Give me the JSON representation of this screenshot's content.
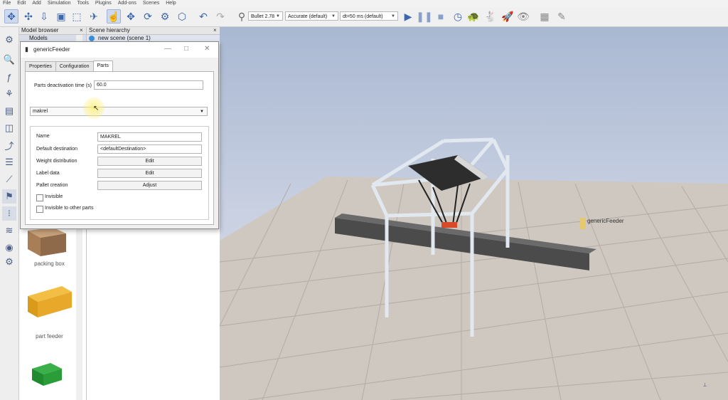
{
  "menu": [
    "File",
    "Edit",
    "Add",
    "Simulation",
    "Tools",
    "Plugins",
    "Add-ons",
    "Scenes",
    "Help"
  ],
  "toolbar": {
    "engine": "Bullet 2.78",
    "accuracy": "Accurate (default)",
    "timestep": "dt=50 ms (default)"
  },
  "panes": {
    "model_browser_title": "Model browser",
    "scene_hierarchy_title": "Scene hierarchy",
    "models_root": "Models",
    "scene_root": "new scene (scene 1)",
    "close_glyph": "×"
  },
  "model_items": [
    "packing box",
    "part feeder"
  ],
  "dialog": {
    "title": "genericFeeder",
    "tabs": [
      "Properties",
      "Configuration",
      "Parts"
    ],
    "active_tab": "Parts",
    "deactivation_label": "Parts deactivation time (s)",
    "deactivation_value": "60.0",
    "selected_part": "makrel",
    "name_label": "Name",
    "name_value": "MAKREL",
    "dest_label": "Default destination",
    "dest_value": "<defaultDestination>",
    "weight_label": "Weight distribution",
    "weight_btn": "Edit",
    "labeldata_label": "Label data",
    "labeldata_btn": "Edit",
    "pallet_label": "Pallet creation",
    "pallet_btn": "Adjust",
    "invisible_label": "Invisible",
    "invisible_others_label": "Invisible to other parts"
  },
  "scene": {
    "feeder_label": "genericFeeder"
  }
}
